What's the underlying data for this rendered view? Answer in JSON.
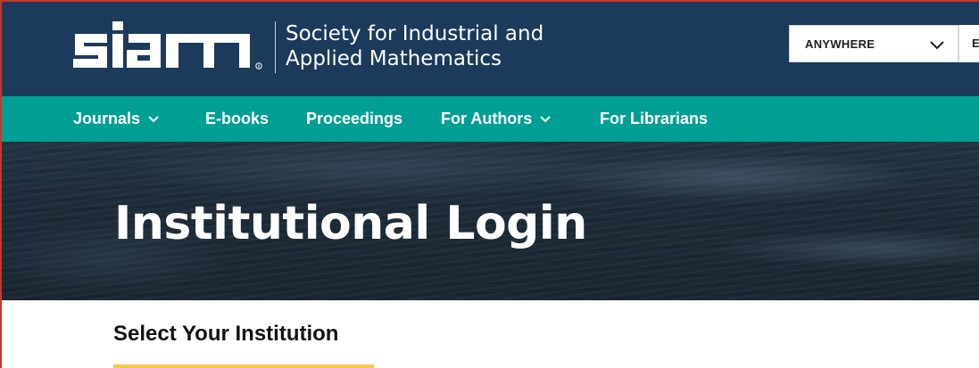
{
  "brand": {
    "logo_text": "siam",
    "tagline_line1": "Society for Industrial and",
    "tagline_line2": "Applied Mathematics"
  },
  "search": {
    "scope_label": "ANYWHERE",
    "next_field_partial": "E"
  },
  "nav": {
    "items": [
      {
        "label": "Journals",
        "has_dropdown": true
      },
      {
        "label": "E-books",
        "has_dropdown": false
      },
      {
        "label": "Proceedings",
        "has_dropdown": false
      },
      {
        "label": "For Authors",
        "has_dropdown": true
      },
      {
        "label": "For Librarians",
        "has_dropdown": false
      }
    ]
  },
  "hero": {
    "title": "Institutional Login"
  },
  "content": {
    "section_title": "Select Your Institution"
  },
  "colors": {
    "header_bg": "#1c3a5c",
    "nav_bg": "#009f95",
    "underline": "#f2c94c"
  }
}
